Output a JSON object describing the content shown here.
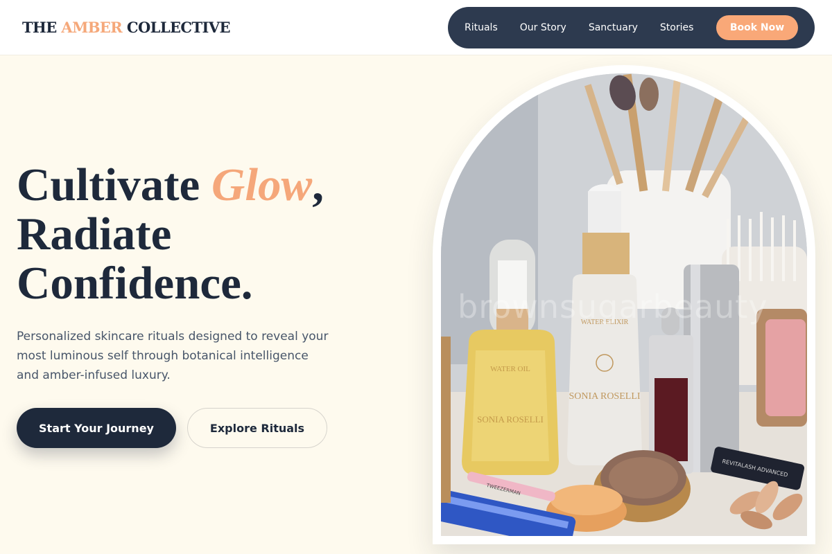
{
  "brand": {
    "prefix": "THE",
    "accent": "AMBER",
    "suffix": "COLLECTIVE"
  },
  "nav": {
    "links": [
      "Rituals",
      "Our Story",
      "Sanctuary",
      "Stories"
    ],
    "cta": "Book Now"
  },
  "hero": {
    "title_part1": "Cultivate",
    "title_accent": "Glow",
    "title_comma": ",",
    "title_line2": "Radiate",
    "title_line3": "Confidence.",
    "description": "Personalized skincare rituals designed to reveal your most luminous self through botanical intelligence and amber-infused luxury.",
    "primary_cta": "Start Your Journey",
    "secondary_cta": "Explore Rituals"
  },
  "image": {
    "watermark": "brownsugarbeauty",
    "serum_label_1": "WATER OIL",
    "serum_label_2": "SONIA ROSELLI",
    "elixir_label_1": "WATER ELIXIR",
    "elixir_label_2": "SONIA ROSELLI",
    "tweezer_label": "TWEEZERMAN",
    "lash_label": "REVITALASH ADVANCED"
  },
  "colors": {
    "accent": "#f5a87a",
    "navy": "#1e293b",
    "nav_bg": "#2d3a4f",
    "page_bg": "#fefaee"
  }
}
